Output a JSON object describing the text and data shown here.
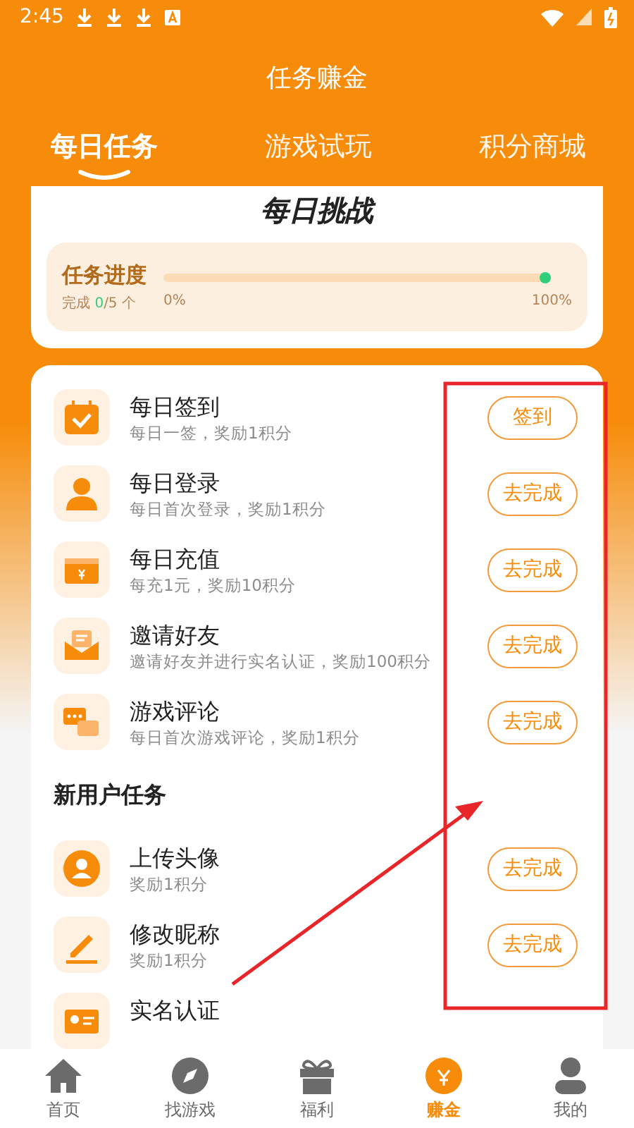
{
  "status_bar": {
    "time": "2:45"
  },
  "header": {
    "title": "任务赚金"
  },
  "tabs": [
    {
      "label": "每日任务",
      "selected": true
    },
    {
      "label": "游戏试玩",
      "selected": false
    },
    {
      "label": "积分商城",
      "selected": false
    }
  ],
  "challenge": {
    "title": "每日挑战",
    "progress_label": "任务进度",
    "count_label": "完成",
    "count_done": "0",
    "count_total": "/5 个",
    "level": 0,
    "start_label": "0%",
    "end_label": "100%"
  },
  "daily_tasks": [
    {
      "title": "每日签到",
      "desc": "每日一签，奖励1积分",
      "button": "签到"
    },
    {
      "title": "每日登录",
      "desc": "每日首次登录，奖励1积分",
      "button": "去完成"
    },
    {
      "title": "每日充值",
      "desc": "每充1元，奖励10积分",
      "button": "去完成"
    },
    {
      "title": "邀请好友",
      "desc": "邀请好友并进行实名认证，奖励100积分",
      "button": "去完成"
    },
    {
      "title": "游戏评论",
      "desc": "每日首次游戏评论，奖励1积分",
      "button": "去完成"
    }
  ],
  "new_user_section": {
    "title": "新用户任务"
  },
  "new_user_tasks": [
    {
      "title": "上传头像",
      "desc": "奖励1积分",
      "button": "去完成"
    },
    {
      "title": "修改昵称",
      "desc": "奖励1积分",
      "button": "去完成"
    },
    {
      "title": "实名认证"
    }
  ],
  "bottom_nav": [
    {
      "label": "首页",
      "selected": false
    },
    {
      "label": "找游戏",
      "selected": false
    },
    {
      "label": "福利",
      "selected": false
    },
    {
      "label": "赚金",
      "selected": true
    },
    {
      "label": "我的",
      "selected": false
    }
  ]
}
